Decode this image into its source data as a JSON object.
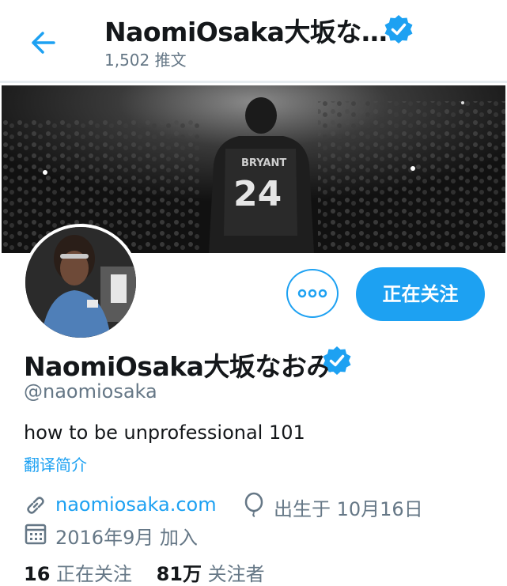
{
  "header": {
    "title": "NaomiOsaka大坂な…",
    "tweet_count": "1,502 推文",
    "back_icon": "arrow-left-icon",
    "verified_icon": "verified-badge-icon"
  },
  "banner": {
    "jersey_name": "BRYANT",
    "jersey_number": "24"
  },
  "actions": {
    "more_icon": "more-dots-icon",
    "follow_label": "正在关注"
  },
  "profile": {
    "display_name": "NaomiOsaka大坂なおみ",
    "handle": "@naomiosaka",
    "bio": "how to be unprofessional 101",
    "translate_label": "翻译简介",
    "website": "naomiosaka.com",
    "birthday": "出生于 10月16日",
    "joined": "2016年9月 加入"
  },
  "stats": {
    "following_count": "16",
    "following_label": "正在关注",
    "followers_count": "81万",
    "followers_label": "关注者"
  },
  "colors": {
    "accent": "#1da1f2",
    "text": "#14171a",
    "secondary": "#657786"
  }
}
